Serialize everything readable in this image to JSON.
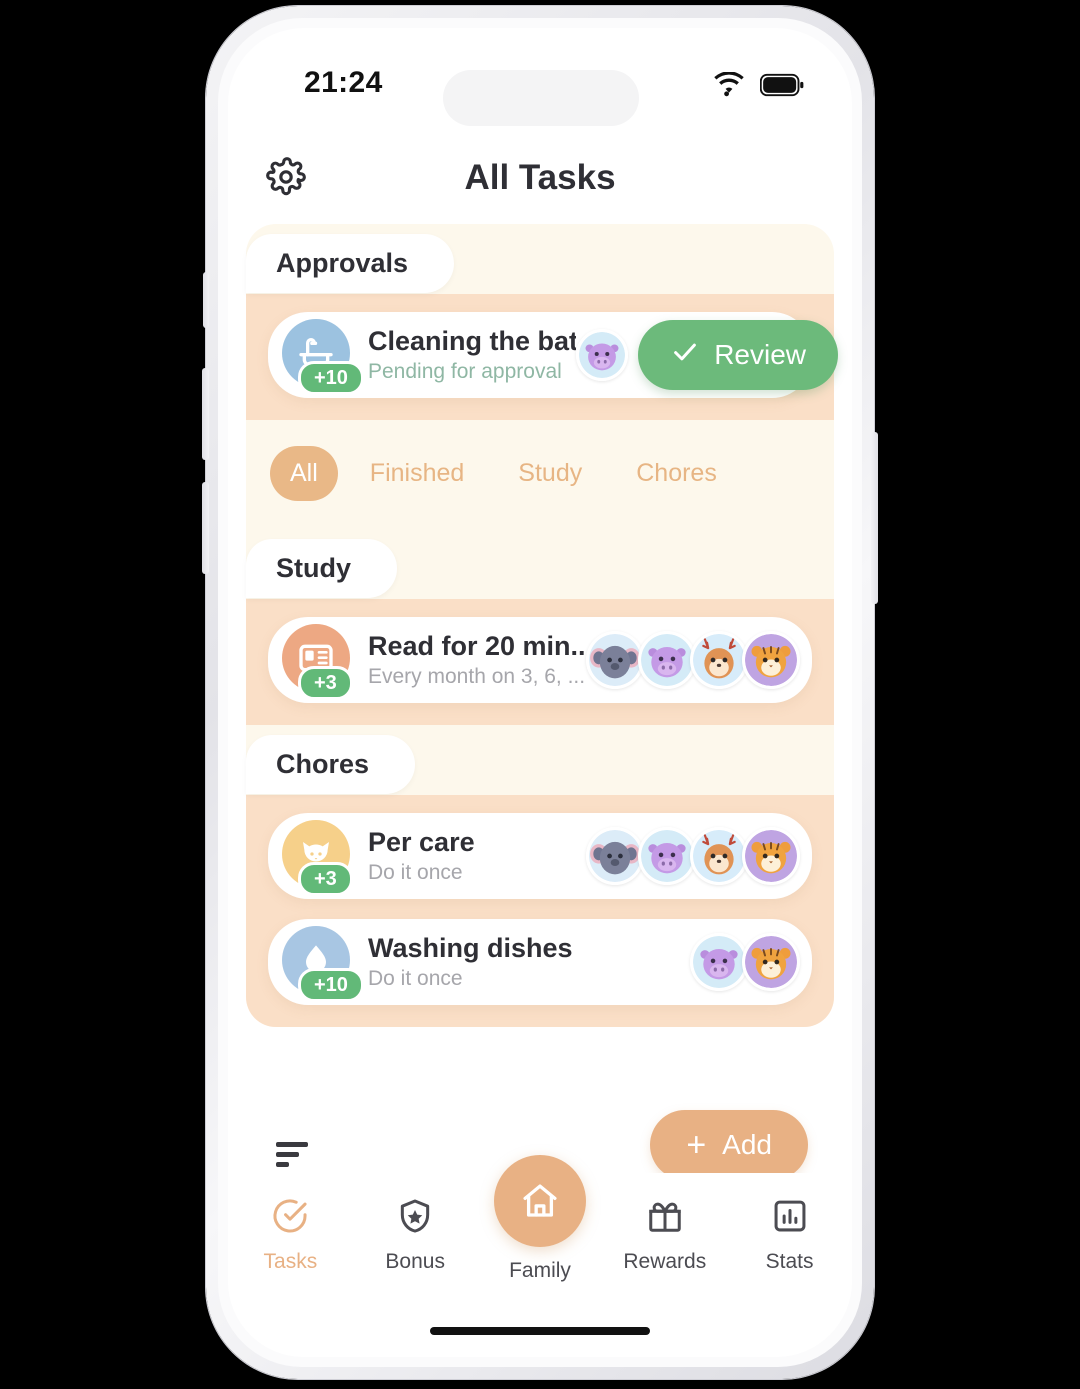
{
  "status_bar": {
    "time": "21:24",
    "wifi_icon": "wifi-icon",
    "battery_icon": "battery-icon"
  },
  "header": {
    "settings_icon": "gear-icon",
    "title": "All Tasks"
  },
  "filters": {
    "items": [
      {
        "label": "All",
        "active": true
      },
      {
        "label": "Finished",
        "active": false
      },
      {
        "label": "Study",
        "active": false
      },
      {
        "label": "Chores",
        "active": false
      }
    ]
  },
  "sections": [
    {
      "title": "Approvals",
      "tasks": [
        {
          "title": "Cleaning the bathro...",
          "subtitle": "Pending for approval",
          "subtitle_style": "pending",
          "points": "+10",
          "icon": "bathtub-icon",
          "icon_bg": "#9cc2e0",
          "avatars": [
            "hippo"
          ],
          "action": {
            "label": "Review",
            "icon": "check-icon",
            "color": "#6cba7b"
          }
        }
      ]
    },
    {
      "title": "Study",
      "tasks": [
        {
          "title": "Read for 20 min...",
          "subtitle": "Every month on  3, 6, ...",
          "subtitle_style": "normal",
          "points": "+3",
          "icon": "book-icon",
          "icon_bg": "#eda883",
          "avatars": [
            "koala",
            "hippo",
            "deer",
            "tiger"
          ],
          "action": null
        }
      ]
    },
    {
      "title": "Chores",
      "tasks": [
        {
          "title": "Per care",
          "subtitle": "Do it once",
          "subtitle_style": "normal",
          "points": "+3",
          "icon": "cat-icon",
          "icon_bg": "#f6d08a",
          "avatars": [
            "koala",
            "hippo",
            "deer",
            "tiger"
          ],
          "action": null
        },
        {
          "title": "Washing dishes",
          "subtitle": "Do it once",
          "subtitle_style": "normal",
          "points": "+10",
          "icon": "water-drop-icon",
          "icon_bg": "#a8c6e3",
          "avatars": [
            "hippo",
            "tiger"
          ],
          "action": null
        }
      ]
    }
  ],
  "action_row": {
    "sort_icon": "sort-lines-icon",
    "add_label": "Add",
    "add_plus": "+",
    "add_color": "#e8b184"
  },
  "bottom_nav": {
    "items": [
      {
        "label": "Tasks",
        "icon": "check-circle-icon",
        "active": true,
        "center": false
      },
      {
        "label": "Bonus",
        "icon": "shield-star-icon",
        "active": false,
        "center": false
      },
      {
        "label": "Family",
        "icon": "home-icon",
        "active": false,
        "center": true
      },
      {
        "label": "Rewards",
        "icon": "gift-icon",
        "active": false,
        "center": false
      },
      {
        "label": "Stats",
        "icon": "bar-chart-icon",
        "active": false,
        "center": false
      }
    ]
  },
  "theme": {
    "panel_bg": "#fdf8ec",
    "section_bg": "#fadfc7",
    "accent": "#e8b184",
    "green": "#62b978"
  }
}
